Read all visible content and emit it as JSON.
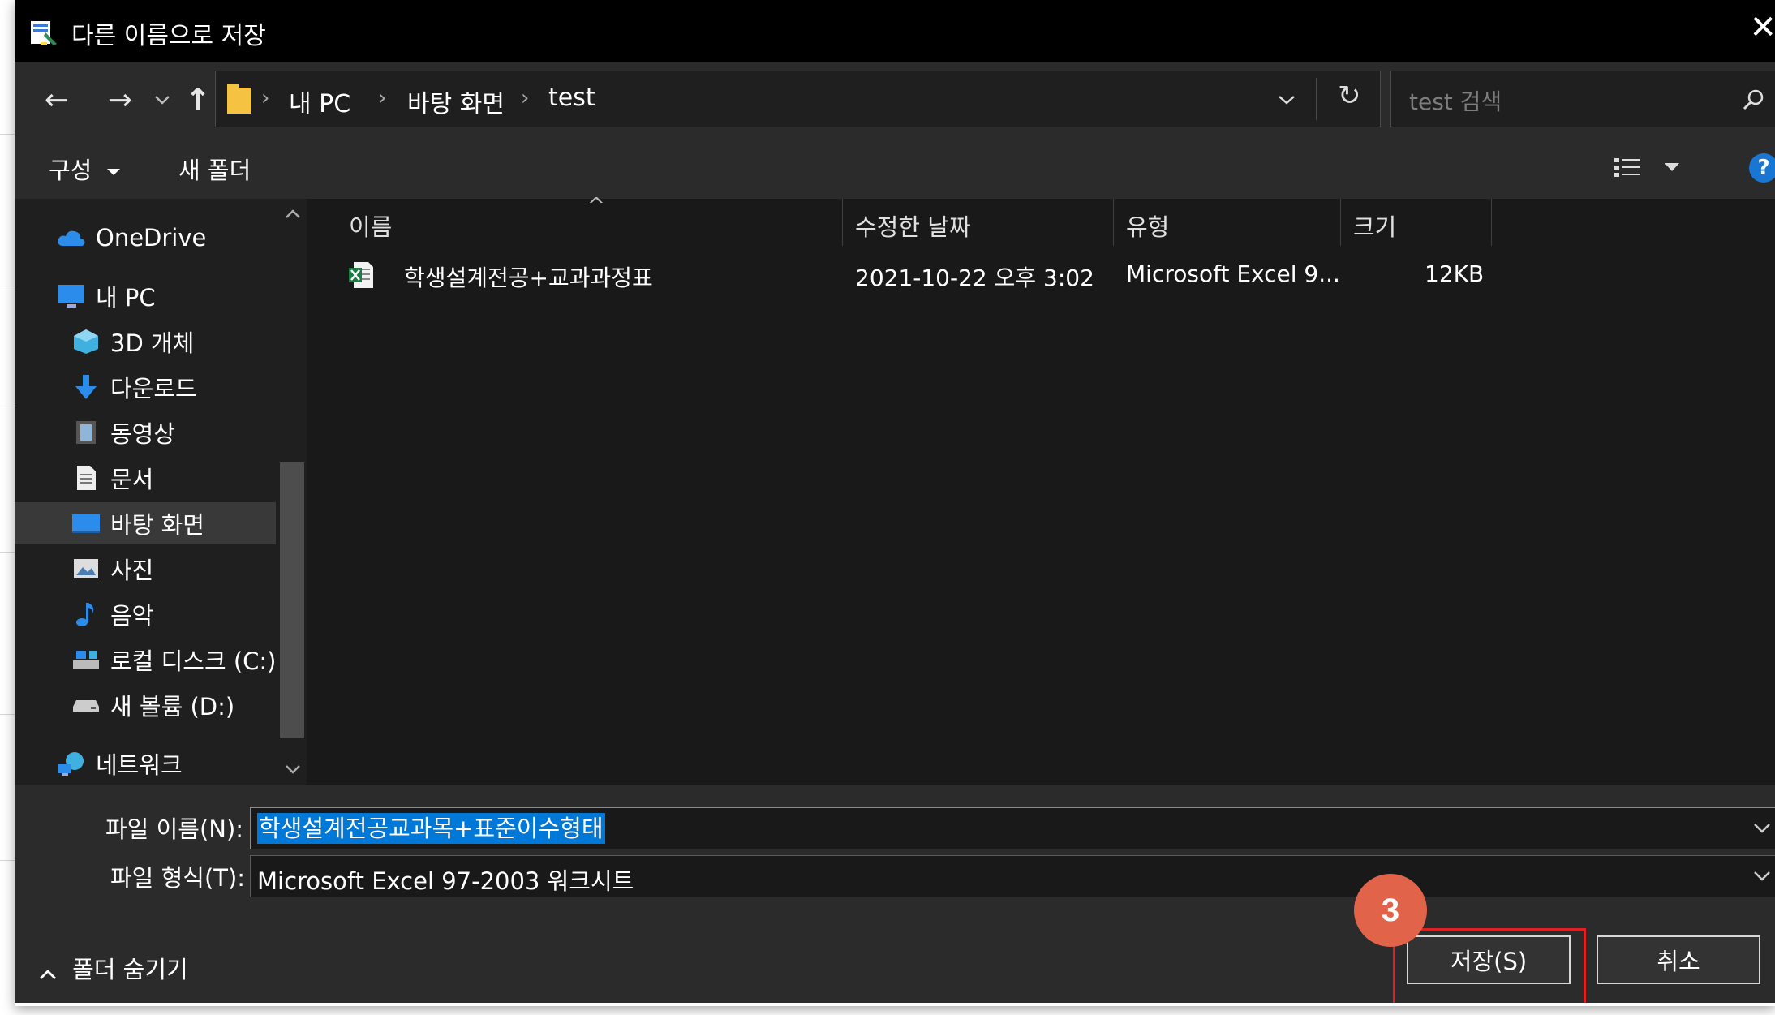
{
  "dialog": {
    "title": "다른 이름으로 저장",
    "close_glyph": "✕"
  },
  "navigation": {
    "back_glyph": "←",
    "forward_glyph": "→",
    "recent_glyph": "⌄",
    "up_glyph": "↑",
    "breadcrumb": [
      "내 PC",
      "바탕 화면",
      "test"
    ],
    "breadcrumb_separator": "›",
    "refresh_glyph": "↻",
    "search_placeholder": "test 검색"
  },
  "toolbar": {
    "organize_label": "구성",
    "new_folder_label": "새 폴더",
    "help_glyph": "?"
  },
  "nav_pane": {
    "items": [
      {
        "label": "OneDrive",
        "icon": "cloud-icon"
      },
      {
        "label": "내 PC",
        "icon": "computer-icon"
      },
      {
        "label": "3D 개체",
        "icon": "cube-icon"
      },
      {
        "label": "다운로드",
        "icon": "download-icon"
      },
      {
        "label": "동영상",
        "icon": "video-icon"
      },
      {
        "label": "문서",
        "icon": "document-icon"
      },
      {
        "label": "바탕 화면",
        "icon": "desktop-icon",
        "selected": true
      },
      {
        "label": "사진",
        "icon": "picture-icon"
      },
      {
        "label": "음악",
        "icon": "music-icon"
      },
      {
        "label": "로컬 디스크 (C:)",
        "icon": "drive-icon"
      },
      {
        "label": "새 볼륨 (D:)",
        "icon": "drive-icon"
      },
      {
        "label": "네트워크",
        "icon": "network-icon"
      }
    ]
  },
  "file_list": {
    "columns": [
      "이름",
      "수정한 날짜",
      "유형",
      "크기"
    ],
    "sort_glyph": "^",
    "rows": [
      {
        "name": "학생설계전공+교과과정표",
        "modified": "2021-10-22 오후 3:02",
        "type": "Microsoft Excel 9...",
        "size": "12KB",
        "icon": "excel-file-icon"
      }
    ]
  },
  "bottom": {
    "filename_label": "파일 이름(N):",
    "filename_value": "학생설계전공교과목+표준이수형태",
    "filetype_label": "파일 형식(T):",
    "filetype_value": "Microsoft Excel 97-2003 워크시트",
    "hide_folders_label": "폴더 숨기기",
    "save_label": "저장(S)",
    "cancel_label": "취소",
    "step_badge": "3"
  },
  "colors": {
    "dialog_bg": "#191919",
    "titlebar_bg": "#000000",
    "selection_blue": "#0078d7",
    "badge_orange": "#e0634a",
    "highlight_red": "#e02020"
  }
}
